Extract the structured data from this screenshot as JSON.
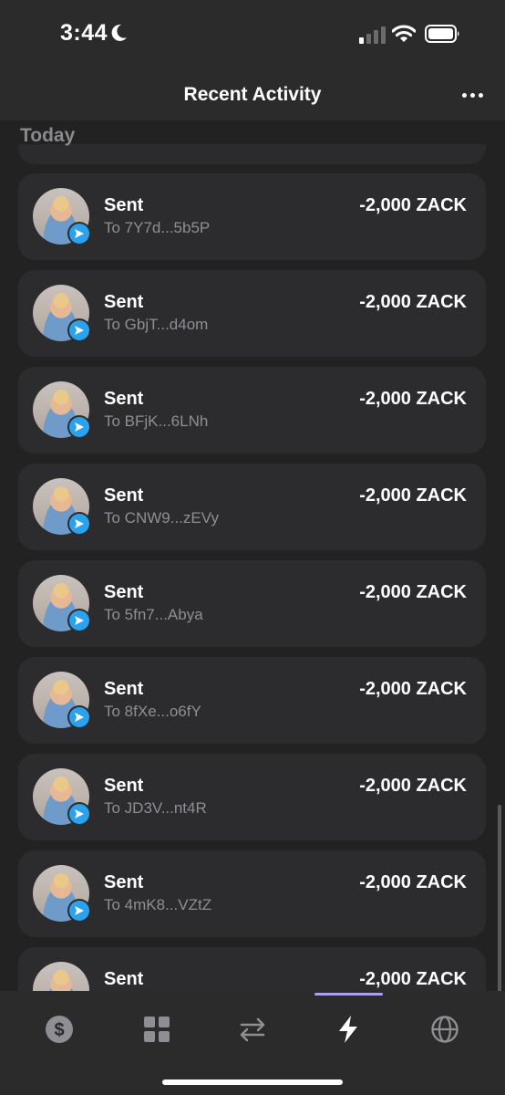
{
  "status_bar": {
    "time": "3:44"
  },
  "header": {
    "title": "Recent Activity"
  },
  "section": {
    "label": "Today"
  },
  "transactions": [
    {
      "title": "Sent",
      "to": "To 7Y7d...5b5P",
      "amount": "-2,000 ZACK"
    },
    {
      "title": "Sent",
      "to": "To GbjT...d4om",
      "amount": "-2,000 ZACK"
    },
    {
      "title": "Sent",
      "to": "To BFjK...6LNh",
      "amount": "-2,000 ZACK"
    },
    {
      "title": "Sent",
      "to": "To CNW9...zEVy",
      "amount": "-2,000 ZACK"
    },
    {
      "title": "Sent",
      "to": "To 5fn7...Abya",
      "amount": "-2,000 ZACK"
    },
    {
      "title": "Sent",
      "to": "To 8fXe...o6fY",
      "amount": "-2,000 ZACK"
    },
    {
      "title": "Sent",
      "to": "To JD3V...nt4R",
      "amount": "-2,000 ZACK"
    },
    {
      "title": "Sent",
      "to": "To 4mK8...VZtZ",
      "amount": "-2,000 ZACK"
    },
    {
      "title": "Sent",
      "to": "",
      "amount": "-2,000 ZACK"
    }
  ],
  "tabs": [
    {
      "icon": "dollar-icon"
    },
    {
      "icon": "grid-icon"
    },
    {
      "icon": "swap-icon"
    },
    {
      "icon": "lightning-icon",
      "active": true
    },
    {
      "icon": "globe-icon"
    }
  ],
  "colors": {
    "background": "#222222",
    "card": "#2c2c2f",
    "badge": "#2aa2ee",
    "accent": "#ab9ff2",
    "secondary_text": "#8e8e93"
  }
}
